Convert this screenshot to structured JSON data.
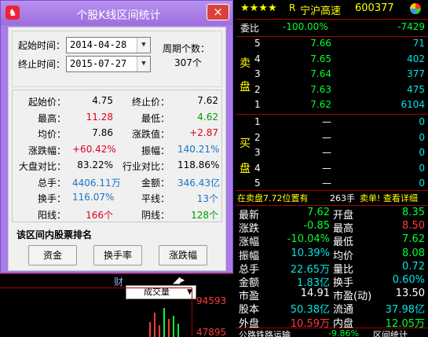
{
  "dialog": {
    "title": "个股K线区间统计",
    "close_symbol": "×",
    "start_time_label": "起始时间：",
    "start_date": "2014-04-28",
    "end_time_label": "终止时间：",
    "end_date": "2015-07-27",
    "period_label": "周期个数：",
    "period_count": "307个",
    "stats": [
      {
        "label": "起始价：",
        "value": "4.75",
        "color": "black"
      },
      {
        "label": "终止价：",
        "value": "7.62",
        "color": "black"
      },
      {
        "label": "最高：",
        "value": "11.28",
        "color": "red"
      },
      {
        "label": "最低：",
        "value": "4.62",
        "color": "green"
      },
      {
        "label": "均价：",
        "value": "7.86",
        "color": "black"
      },
      {
        "label": "涨跌值：",
        "value": "+2.87",
        "color": "red"
      },
      {
        "label": "涨跌幅：",
        "value": "+60.42%",
        "color": "red"
      },
      {
        "label": "振幅：",
        "value": "140.21%",
        "color": "blue"
      },
      {
        "label": "大盘对比：",
        "value": "83.22%",
        "color": "black"
      },
      {
        "label": "行业对比：",
        "value": "118.86%",
        "color": "black"
      },
      {
        "label": "总手：",
        "value": "4406.11万",
        "color": "blue"
      },
      {
        "label": "金额：",
        "value": "346.43亿",
        "color": "blue"
      },
      {
        "label": "换手：",
        "value": "116.07%",
        "color": "blue"
      },
      {
        "label": "平线：",
        "value": "13个",
        "color": "blue"
      },
      {
        "label": "阳线：",
        "value": "166个",
        "color": "red"
      },
      {
        "label": "阴线：",
        "value": "128个",
        "color": "green"
      }
    ],
    "ranking_label": "该区间内股票排名",
    "buttons": {
      "amount": "资金",
      "turnover": "换手率",
      "change": "涨跌幅"
    }
  },
  "background": {
    "tab_label": "财",
    "volume_label": "成交量",
    "axis_top": "94593",
    "axis_bottom": "47895"
  },
  "quote": {
    "stars": "★★★★",
    "r_mark": "R",
    "name": "宁沪高速",
    "code": "600377",
    "weibi_label": "委比",
    "weibi_value": "-100.00%",
    "weicha_value": "-7429",
    "sell_label_1": "卖",
    "sell_label_2": "盘",
    "sell": [
      {
        "level": "5",
        "price": "7.66",
        "vol": "71"
      },
      {
        "level": "4",
        "price": "7.65",
        "vol": "402"
      },
      {
        "level": "3",
        "price": "7.64",
        "vol": "377"
      },
      {
        "level": "2",
        "price": "7.63",
        "vol": "475"
      },
      {
        "level": "1",
        "price": "7.62",
        "vol": "6104"
      }
    ],
    "buy_label_1": "买",
    "buy_label_2": "盘",
    "buy": [
      {
        "level": "1",
        "price": "—",
        "vol": "0"
      },
      {
        "level": "2",
        "price": "—",
        "vol": "0"
      },
      {
        "level": "3",
        "price": "—",
        "vol": "0"
      },
      {
        "level": "4",
        "price": "—",
        "vol": "0"
      },
      {
        "level": "5",
        "price": "—",
        "vol": "0"
      }
    ],
    "info_left": "在卖盘7.72位置有",
    "info_mid": "263手",
    "info_right": "卖单! 查看详细",
    "rows": [
      {
        "l1": "最新",
        "v1": "7.62",
        "c1": "gr",
        "l2": "开盘",
        "v2": "8.35",
        "c2": "gr"
      },
      {
        "l1": "涨跌",
        "v1": "-0.85",
        "c1": "gr",
        "l2": "最高",
        "v2": "8.50",
        "c2": "rd"
      },
      {
        "l1": "涨幅",
        "v1": "-10.04%",
        "c1": "gr",
        "l2": "最低",
        "v2": "7.62",
        "c2": "gr"
      },
      {
        "l1": "振幅",
        "v1": "10.39%",
        "c1": "cy",
        "l2": "均价",
        "v2": "8.08",
        "c2": "gr"
      },
      {
        "l1": "总手",
        "v1": "22.65万",
        "c1": "cy",
        "l2": "量比",
        "v2": "0.72",
        "c2": "cy"
      },
      {
        "l1": "金额",
        "v1": "1.83亿",
        "c1": "cy",
        "l2": "换手",
        "v2": "0.60%",
        "c2": "cy"
      },
      {
        "l1": "市盈",
        "v1": "14.91",
        "c1": "wht",
        "l2": "市盈(动)",
        "v2": "13.50",
        "c2": "wht"
      },
      {
        "l1": "股本",
        "v1": "50.38亿",
        "c1": "cy",
        "l2": "流通",
        "v2": "37.98亿",
        "c2": "cy"
      },
      {
        "l1": "外盘",
        "v1": "10.59万",
        "c1": "rd",
        "l2": "内盘",
        "v2": "12.05万",
        "c2": "gr"
      }
    ],
    "bottom_label": "公路铁路运输",
    "bottom_value": "-9.86%",
    "bottom_right": "区间统计"
  }
}
